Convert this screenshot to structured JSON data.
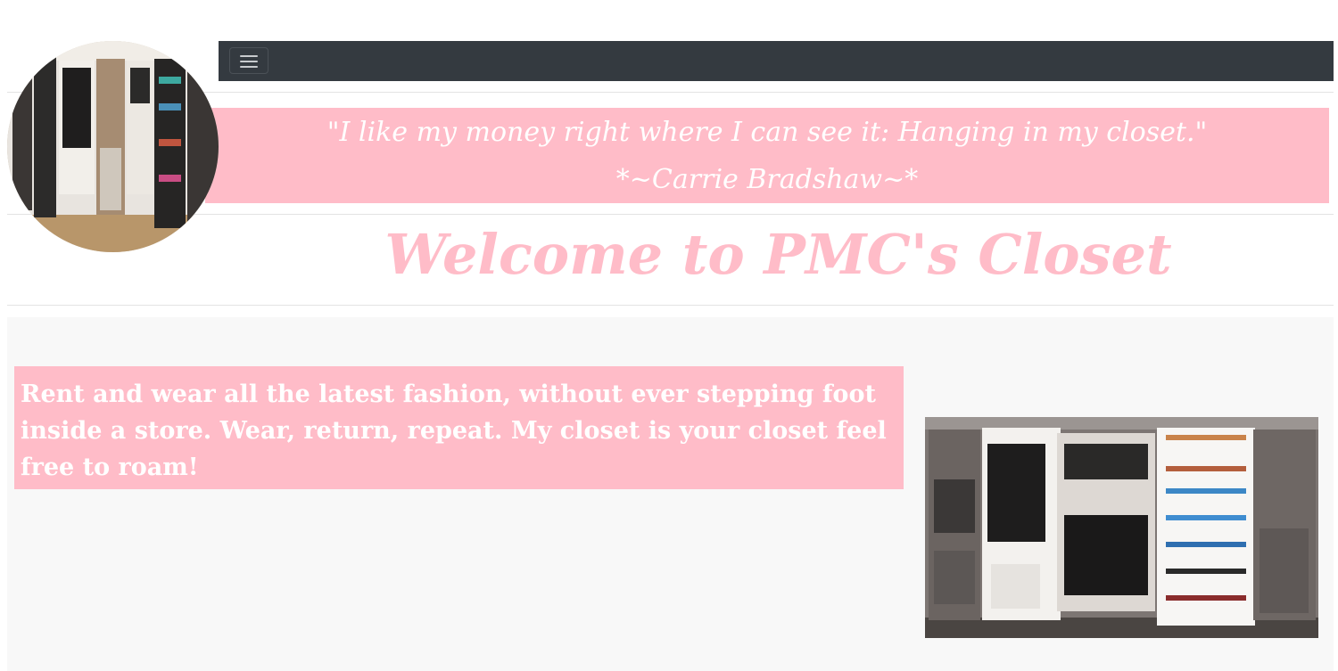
{
  "navbar": {
    "toggle_icon": "hamburger-menu-icon",
    "background": "#343a40"
  },
  "quote": {
    "text": "\"I like my money right where I can see it: Hanging in my closet.\"",
    "author": "*~Carrie Bradshaw~*"
  },
  "heading": "Welcome to PMC's Closet",
  "intro": "Rent and wear all the latest fashion, without ever stepping foot inside a store. Wear, return, repeat. My closet is your closet feel free to roam!",
  "colors": {
    "accent": "#ffbcc8",
    "navbar": "#343a40",
    "section_bg": "#f8f8f8"
  }
}
